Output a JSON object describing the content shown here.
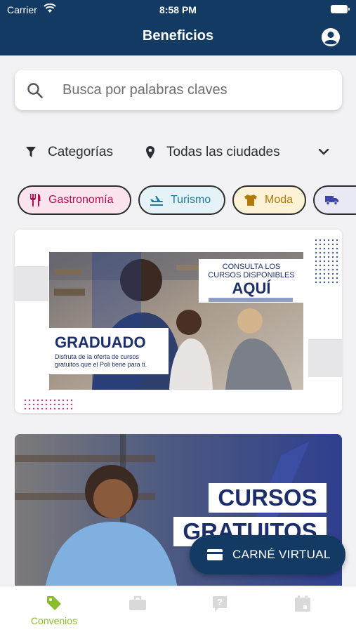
{
  "status": {
    "carrier": "Carrier",
    "time": "8:58 PM"
  },
  "header": {
    "title": "Beneficios"
  },
  "search": {
    "placeholder": "Busca por palabras claves"
  },
  "filters": {
    "category_label": "Categorías",
    "city_label": "Todas las ciudades"
  },
  "chips": [
    {
      "label": "Gastronomía",
      "icon": "utensils-icon"
    },
    {
      "label": "Turismo",
      "icon": "airplane-icon"
    },
    {
      "label": "Moda",
      "icon": "shirt-icon"
    },
    {
      "label": "",
      "icon": "truck-icon"
    }
  ],
  "banner1": {
    "cta_line1": "CONSULTA LOS",
    "cta_line2": "CURSOS DISPONIBLES",
    "cta_big": "AQUÍ",
    "title": "GRADUADO",
    "body_line1": "Disfruta de la oferta de cursos",
    "body_line2": "gratuitos que el Poli tiene para ti."
  },
  "banner2": {
    "line1": "CURSOS",
    "line2": "GRATUITOS"
  },
  "fab": {
    "label": "CARNÉ VIRTUAL",
    "icon": "card-icon"
  },
  "tabbar": {
    "active_label": "Convenios",
    "items": [
      {
        "icon": "tag-icon",
        "label": "Convenios",
        "active": true
      },
      {
        "icon": "briefcase-icon",
        "label": "",
        "active": false
      },
      {
        "icon": "question-icon",
        "label": "",
        "active": false
      },
      {
        "icon": "calendar-icon",
        "label": "",
        "active": false
      }
    ]
  },
  "colors": {
    "primary": "#123a63",
    "accent_green": "#8bbd2c",
    "gastronomia": "#b3124c",
    "turismo": "#1f7a9c",
    "moda": "#b2780a",
    "transporte": "#3c45a8"
  }
}
